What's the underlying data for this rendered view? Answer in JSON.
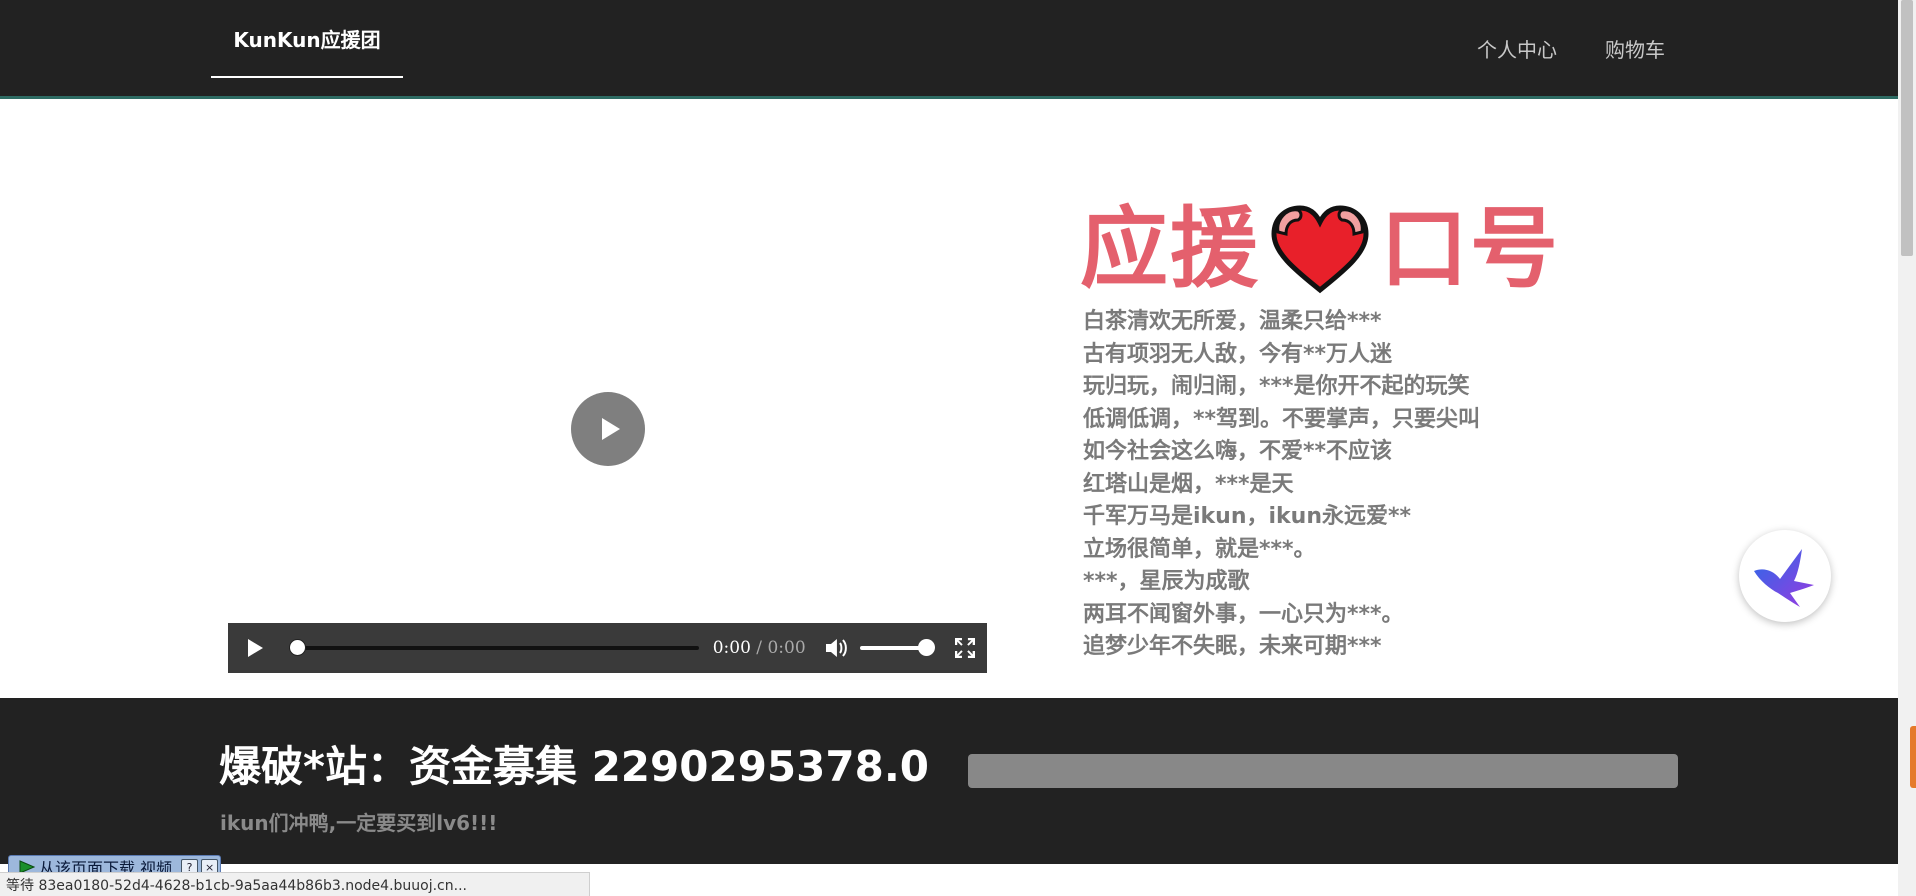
{
  "nav": {
    "brand": "KunKun应援团",
    "links": [
      "个人中心",
      "购物车"
    ]
  },
  "audio": {
    "current_time": "0:00",
    "separator": " / ",
    "duration": "0:00",
    "progress": 0,
    "volume": 1.0
  },
  "slogan": {
    "title_left": "应援",
    "title_right": "口号",
    "lines": [
      "白茶清欢无所爱，温柔只给***",
      "古有项羽无人敌，今有**万人迷",
      "玩归玩，闹归闹，***是你开不起的玩笑",
      "低调低调，**驾到。不要掌声，只要尖叫",
      "如今社会这么嗨，不爱**不应该",
      "红塔山是烟，***是天",
      "千军万马是ikun，ikun永远爱**",
      "立场很简单，就是***。",
      "***，星辰为成歌",
      "两耳不闻窗外事，一心只为***。",
      "追梦少年不失眠，未来可期***"
    ]
  },
  "footer": {
    "title": "爆破*站：资金募集 2290295378.0",
    "subtitle": "ikun们冲鸭,一定要买到lv6!!!",
    "progress_fraction": 1.0
  },
  "download_bar": {
    "label": "从该页面下载 视频",
    "help": "?",
    "close": "×"
  },
  "statusbar": {
    "text": "等待 83ea0180-52d4-4628-b1cb-9a5aa44b86b3.node4.buuoj.cn..."
  },
  "colors": {
    "nav_bg": "#222222",
    "accent_red": "#e4606d",
    "slogan_text": "#7a7a7a",
    "footer_bg": "#222222"
  }
}
